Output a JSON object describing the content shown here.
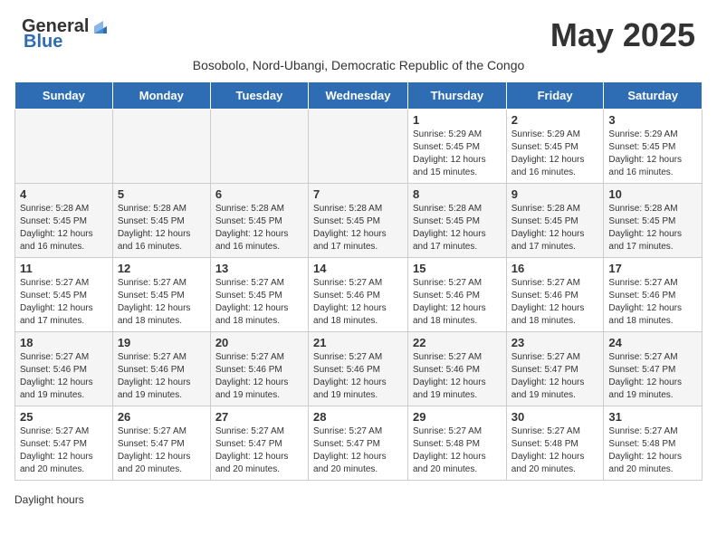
{
  "logo": {
    "general": "General",
    "blue": "Blue"
  },
  "title": "May 2025",
  "subtitle": "Bosobolo, Nord-Ubangi, Democratic Republic of the Congo",
  "days_of_week": [
    "Sunday",
    "Monday",
    "Tuesday",
    "Wednesday",
    "Thursday",
    "Friday",
    "Saturday"
  ],
  "footer": {
    "daylight_label": "Daylight hours"
  },
  "weeks": [
    [
      {
        "day": "",
        "info": ""
      },
      {
        "day": "",
        "info": ""
      },
      {
        "day": "",
        "info": ""
      },
      {
        "day": "",
        "info": ""
      },
      {
        "day": "1",
        "info": "Sunrise: 5:29 AM\nSunset: 5:45 PM\nDaylight: 12 hours and 15 minutes."
      },
      {
        "day": "2",
        "info": "Sunrise: 5:29 AM\nSunset: 5:45 PM\nDaylight: 12 hours and 16 minutes."
      },
      {
        "day": "3",
        "info": "Sunrise: 5:29 AM\nSunset: 5:45 PM\nDaylight: 12 hours and 16 minutes."
      }
    ],
    [
      {
        "day": "4",
        "info": "Sunrise: 5:28 AM\nSunset: 5:45 PM\nDaylight: 12 hours and 16 minutes."
      },
      {
        "day": "5",
        "info": "Sunrise: 5:28 AM\nSunset: 5:45 PM\nDaylight: 12 hours and 16 minutes."
      },
      {
        "day": "6",
        "info": "Sunrise: 5:28 AM\nSunset: 5:45 PM\nDaylight: 12 hours and 16 minutes."
      },
      {
        "day": "7",
        "info": "Sunrise: 5:28 AM\nSunset: 5:45 PM\nDaylight: 12 hours and 17 minutes."
      },
      {
        "day": "8",
        "info": "Sunrise: 5:28 AM\nSunset: 5:45 PM\nDaylight: 12 hours and 17 minutes."
      },
      {
        "day": "9",
        "info": "Sunrise: 5:28 AM\nSunset: 5:45 PM\nDaylight: 12 hours and 17 minutes."
      },
      {
        "day": "10",
        "info": "Sunrise: 5:28 AM\nSunset: 5:45 PM\nDaylight: 12 hours and 17 minutes."
      }
    ],
    [
      {
        "day": "11",
        "info": "Sunrise: 5:27 AM\nSunset: 5:45 PM\nDaylight: 12 hours and 17 minutes."
      },
      {
        "day": "12",
        "info": "Sunrise: 5:27 AM\nSunset: 5:45 PM\nDaylight: 12 hours and 18 minutes."
      },
      {
        "day": "13",
        "info": "Sunrise: 5:27 AM\nSunset: 5:45 PM\nDaylight: 12 hours and 18 minutes."
      },
      {
        "day": "14",
        "info": "Sunrise: 5:27 AM\nSunset: 5:46 PM\nDaylight: 12 hours and 18 minutes."
      },
      {
        "day": "15",
        "info": "Sunrise: 5:27 AM\nSunset: 5:46 PM\nDaylight: 12 hours and 18 minutes."
      },
      {
        "day": "16",
        "info": "Sunrise: 5:27 AM\nSunset: 5:46 PM\nDaylight: 12 hours and 18 minutes."
      },
      {
        "day": "17",
        "info": "Sunrise: 5:27 AM\nSunset: 5:46 PM\nDaylight: 12 hours and 18 minutes."
      }
    ],
    [
      {
        "day": "18",
        "info": "Sunrise: 5:27 AM\nSunset: 5:46 PM\nDaylight: 12 hours and 19 minutes."
      },
      {
        "day": "19",
        "info": "Sunrise: 5:27 AM\nSunset: 5:46 PM\nDaylight: 12 hours and 19 minutes."
      },
      {
        "day": "20",
        "info": "Sunrise: 5:27 AM\nSunset: 5:46 PM\nDaylight: 12 hours and 19 minutes."
      },
      {
        "day": "21",
        "info": "Sunrise: 5:27 AM\nSunset: 5:46 PM\nDaylight: 12 hours and 19 minutes."
      },
      {
        "day": "22",
        "info": "Sunrise: 5:27 AM\nSunset: 5:46 PM\nDaylight: 12 hours and 19 minutes."
      },
      {
        "day": "23",
        "info": "Sunrise: 5:27 AM\nSunset: 5:47 PM\nDaylight: 12 hours and 19 minutes."
      },
      {
        "day": "24",
        "info": "Sunrise: 5:27 AM\nSunset: 5:47 PM\nDaylight: 12 hours and 19 minutes."
      }
    ],
    [
      {
        "day": "25",
        "info": "Sunrise: 5:27 AM\nSunset: 5:47 PM\nDaylight: 12 hours and 20 minutes."
      },
      {
        "day": "26",
        "info": "Sunrise: 5:27 AM\nSunset: 5:47 PM\nDaylight: 12 hours and 20 minutes."
      },
      {
        "day": "27",
        "info": "Sunrise: 5:27 AM\nSunset: 5:47 PM\nDaylight: 12 hours and 20 minutes."
      },
      {
        "day": "28",
        "info": "Sunrise: 5:27 AM\nSunset: 5:47 PM\nDaylight: 12 hours and 20 minutes."
      },
      {
        "day": "29",
        "info": "Sunrise: 5:27 AM\nSunset: 5:48 PM\nDaylight: 12 hours and 20 minutes."
      },
      {
        "day": "30",
        "info": "Sunrise: 5:27 AM\nSunset: 5:48 PM\nDaylight: 12 hours and 20 minutes."
      },
      {
        "day": "31",
        "info": "Sunrise: 5:27 AM\nSunset: 5:48 PM\nDaylight: 12 hours and 20 minutes."
      }
    ]
  ]
}
